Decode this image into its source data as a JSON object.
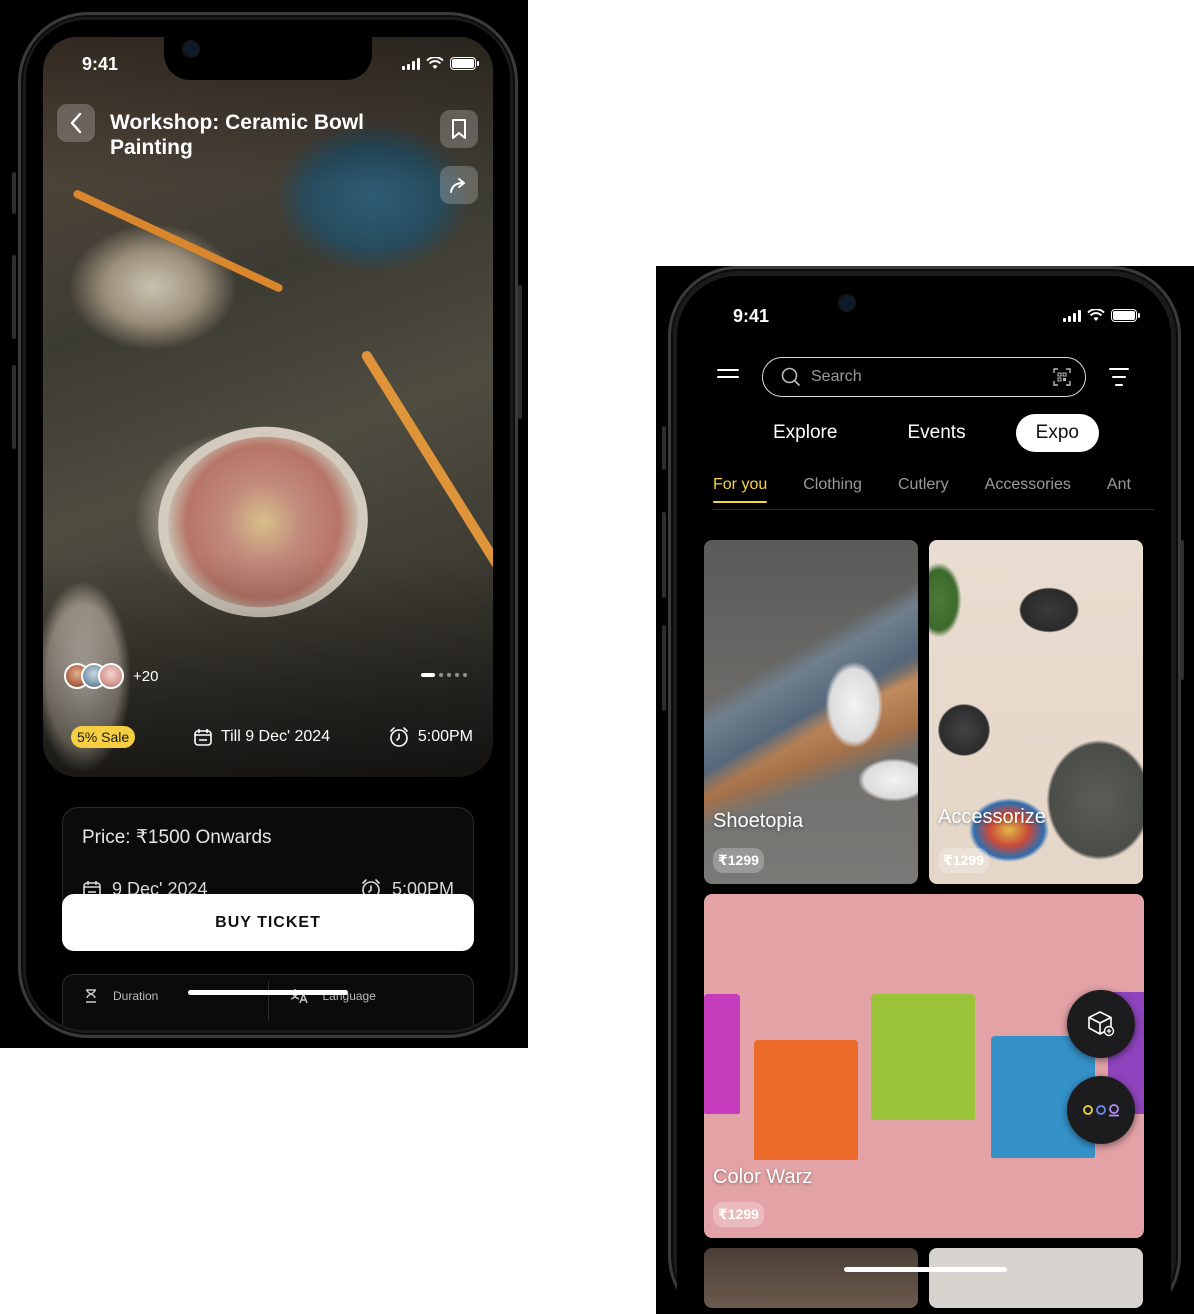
{
  "phone1": {
    "status": {
      "time": "9:41"
    },
    "event": {
      "title": "Workshop: Ceramic Bowl Painting",
      "attendees_extra": "+20",
      "sale_badge": "5% Sale",
      "till_date": "Till 9 Dec' 2024",
      "time": "5:00PM",
      "carousel_pages": 5,
      "carousel_active": 1
    },
    "details": {
      "price": "Price: ₹1500 Onwards",
      "date": "9 Dec' 2024",
      "time": "5:00PM"
    },
    "buy_button": "BUY TICKET",
    "info": {
      "duration_label": "Duration",
      "language_label": "Language"
    },
    "icons": [
      "chevron-left-icon",
      "bookmark-icon",
      "share-icon",
      "calendar-icon",
      "alarm-clock-icon",
      "hourglass-icon",
      "translate-icon"
    ]
  },
  "phone2": {
    "status": {
      "time": "9:41"
    },
    "search": {
      "placeholder": "Search"
    },
    "top_tabs": [
      {
        "label": "Explore",
        "active": false
      },
      {
        "label": "Events",
        "active": false
      },
      {
        "label": "Expo",
        "active": true
      }
    ],
    "sub_tabs": [
      {
        "label": "For you",
        "active": true
      },
      {
        "label": "Clothing",
        "active": false
      },
      {
        "label": "Cutlery",
        "active": false
      },
      {
        "label": "Accessories",
        "active": false
      },
      {
        "label": "Ant",
        "active": false
      }
    ],
    "tiles": [
      {
        "name": "Shoetopia",
        "price": "₹1299"
      },
      {
        "name": "Accessorize",
        "price": "₹1299"
      },
      {
        "name": "Color Warz",
        "price": "₹1299"
      }
    ],
    "icons": [
      "menu-icon",
      "search-icon",
      "qr-scan-icon",
      "filter-icon",
      "box-add-icon",
      "more-options-icon"
    ]
  },
  "colors": {
    "accent_yellow": "#f5d442",
    "sale_yellow": "#f5cf41",
    "background": "#000000",
    "tile_pink": "#e3a3a6"
  }
}
